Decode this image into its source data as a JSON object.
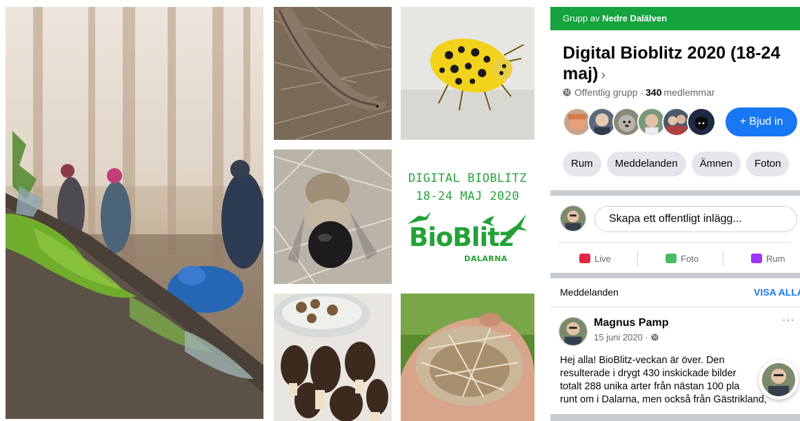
{
  "collage": {
    "poster": {
      "line1": "DIGITAL BIOBLITZ",
      "line2": "18-24 MAJ 2020",
      "logo_word": "BioBlitz",
      "logo_sub": "DALARNA"
    }
  },
  "fb": {
    "header_prefix": "Grupp av ",
    "header_group": "Nedre Dalälven",
    "title": "Digital Bioblitz 2020 (18-24 maj)",
    "title_chevron": "›",
    "privacy": "Offentlig grupp ·",
    "member_count": "340",
    "members_label": "medlemmar",
    "invite_label": "+ Bjud in",
    "tabs": [
      "Rum",
      "Meddelanden",
      "Ämnen",
      "Foton"
    ],
    "composer_placeholder": "Skapa ett offentligt inlägg...",
    "actions": [
      {
        "label": "Live",
        "icon": "live-video-icon",
        "color": "#e42645"
      },
      {
        "label": "Foto",
        "icon": "photo-icon",
        "color": "#45bd62"
      },
      {
        "label": "Rum",
        "icon": "rooms-icon",
        "color": "#a033ff"
      }
    ],
    "announcements_title": "Meddelanden",
    "view_all_label": "VISA ALLA",
    "post": {
      "author": "Magnus Pamp",
      "date": "15 juni 2020 ·",
      "more": "···",
      "body": "Hej alla! BioBlitz-veckan är över. Den\nresulterade i drygt 430 inskickade bilder\ntotalt 288 unika arter från nästan 100 pla\nrunt om i Dalarna, men också från Gästrikland,"
    },
    "colors": {
      "header_green": "#14a33c",
      "accent_blue": "#1877f2",
      "poster_green": "#22a236"
    }
  }
}
